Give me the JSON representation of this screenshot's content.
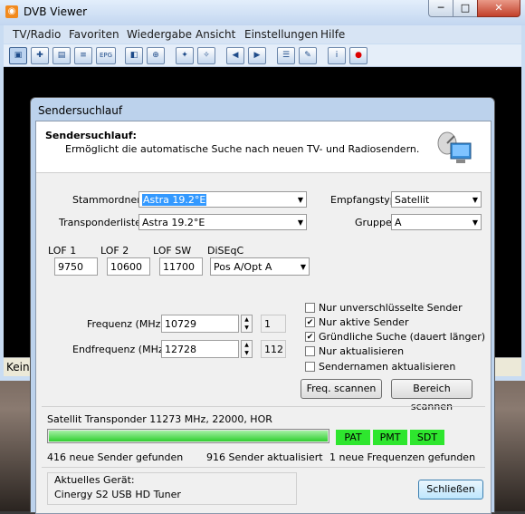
{
  "app": {
    "title": "DVB Viewer",
    "icon": "rss-icon"
  },
  "menu": [
    "TV/Radio",
    "Favoriten",
    "Wiedergabe",
    "Ansicht",
    "Einstellungen",
    "Hilfe"
  ],
  "status": {
    "text": "Keine"
  },
  "toolbar": {
    "icons": [
      "window-icon",
      "plus-icon",
      "bookmark-icon",
      "list-icon",
      "epg-icon",
      "channel-prev-icon",
      "channel-next-icon",
      "favorite-prev-icon",
      "favorite-next-icon",
      "back-icon",
      "forward-icon",
      "playlist-icon",
      "settings-icon",
      "info-icon",
      "record-icon"
    ],
    "epg_label": "EPG"
  },
  "dialog": {
    "title": "Sendersuchlauf",
    "header_title": "Sendersuchlauf:",
    "header_sub": "Ermöglicht die automatische Suche nach neuen TV- und Radiosendern.",
    "stammordner_label": "Stammordner",
    "stammordner_value": "Astra 19.2°E",
    "transponderliste_label": "Transponderliste",
    "transponderliste_value": "Astra 19.2°E",
    "empfangstyp_label": "Empfangstyp",
    "empfangstyp_value": "Satellit",
    "gruppe_label": "Gruppe",
    "gruppe_value": "A",
    "lof1_label": "LOF 1",
    "lof1_value": "9750",
    "lof2_label": "LOF 2",
    "lof2_value": "10600",
    "lofsw_label": "LOF SW",
    "lofsw_value": "11700",
    "diseqc_label": "DiSEqC",
    "diseqc_value": "Pos A/Opt A",
    "frequenz_label": "Frequenz (MHz)",
    "frequenz_value": "10729",
    "frequenz_index": "1",
    "endfrequenz_label": "Endfrequenz (MHz)",
    "endfrequenz_value": "12728",
    "endfrequenz_index": "112",
    "checkboxes": [
      {
        "label": "Nur unverschlüsselte Sender",
        "checked": false
      },
      {
        "label": "Nur aktive Sender",
        "checked": true
      },
      {
        "label": "Gründliche Suche (dauert länger)",
        "checked": true
      },
      {
        "label": "Nur aktualisieren",
        "checked": false
      },
      {
        "label": "Sendernamen aktualisieren",
        "checked": false
      }
    ],
    "freq_scan_button": "Freq. scannen",
    "range_scan_button": "Bereich scannen",
    "transponder_status": "Satellit Transponder  11273 MHz, 22000, HOR",
    "progress": 1.0,
    "pills": [
      "PAT",
      "PMT",
      "SDT"
    ],
    "new_channels": "416 neue Sender gefunden",
    "updated_channels": "916 Sender aktualisiert",
    "new_frequencies": "1 neue Frequenzen gefunden",
    "device_label": "Aktuelles Gerät:",
    "device_value": "Cinergy S2 USB HD Tuner",
    "close_button": "Schließen",
    "colors": {
      "progress": "#2fcf2f",
      "pill": "#2ee62e",
      "accent": "#3399ff"
    }
  }
}
